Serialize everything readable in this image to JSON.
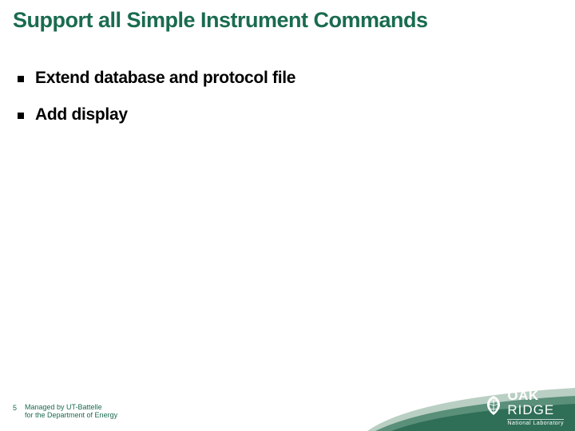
{
  "colors": {
    "accent": "#1a6b4f",
    "swoosh_dark": "#2f6e57",
    "swoosh_mid": "#5a8f7a",
    "swoosh_light": "#b9cfc3"
  },
  "title": "Support all Simple Instrument Commands",
  "bullets": [
    "Extend database and protocol file",
    "Add display"
  ],
  "footer": {
    "page_number": "5",
    "managed_line1": "Managed by UT-Battelle",
    "managed_line2": "for the Department of Energy"
  },
  "logo": {
    "line1_a": "OAK",
    "line1_b": "RIDGE",
    "sub": "National Laboratory",
    "icon": "oak-leaf-icon"
  }
}
